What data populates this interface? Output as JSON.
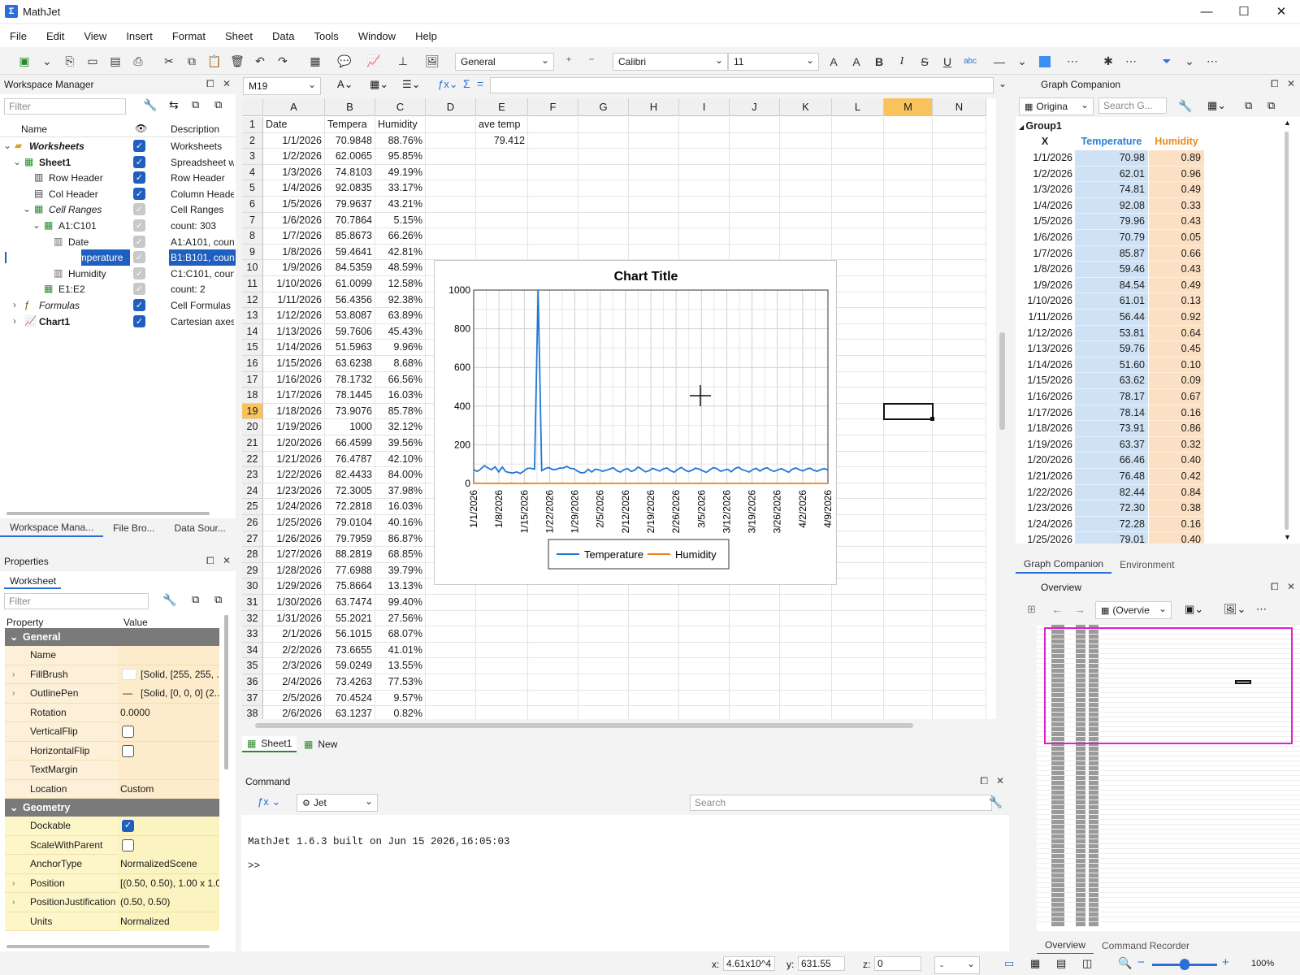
{
  "app": {
    "title": "MathJet"
  },
  "menu": [
    "File",
    "Edit",
    "View",
    "Insert",
    "Format",
    "Sheet",
    "Data",
    "Tools",
    "Window",
    "Help"
  ],
  "toolbar": {
    "number_format": "General",
    "font_name": "Calibri",
    "font_size": "11"
  },
  "workspace": {
    "title": "Workspace Manager",
    "filter_placeholder": "Filter",
    "col_name": "Name",
    "col_desc": "Description",
    "rows": [
      {
        "name": "Worksheets",
        "desc": "Worksheets",
        "indent": 0,
        "bold": true,
        "italic": true,
        "check": "on",
        "expand": "⌄",
        "icon": "folder-icon"
      },
      {
        "name": "Sheet1",
        "desc": "Spreadsheet wi",
        "indent": 1,
        "bold": true,
        "italic": false,
        "check": "on",
        "expand": "⌄",
        "icon": "sheet-icon"
      },
      {
        "name": "Row Header",
        "desc": "Row Header",
        "indent": 2,
        "bold": false,
        "italic": false,
        "check": "on",
        "expand": "",
        "icon": "row-header-icon"
      },
      {
        "name": "Col Header",
        "desc": "Column Heade",
        "indent": 2,
        "bold": false,
        "italic": false,
        "check": "on",
        "expand": "",
        "icon": "col-header-icon"
      },
      {
        "name": "Cell Ranges",
        "desc": "Cell Ranges",
        "indent": 2,
        "bold": false,
        "italic": true,
        "check": "gray",
        "expand": "⌄",
        "icon": "cell-ranges-icon"
      },
      {
        "name": "A1:C101",
        "desc": "count: 303",
        "indent": 3,
        "bold": false,
        "italic": false,
        "check": "gray",
        "expand": "⌄",
        "icon": "range-icon"
      },
      {
        "name": "Date",
        "desc": "A1:A101, count",
        "indent": 4,
        "bold": false,
        "italic": false,
        "check": "gray",
        "expand": "",
        "icon": "column-icon"
      },
      {
        "name": "Temperature",
        "desc": "B1:B101, count",
        "indent": 4,
        "bold": false,
        "italic": false,
        "check": "gray",
        "expand": "",
        "icon": "column-icon",
        "selected": true
      },
      {
        "name": "Humidity",
        "desc": "C1:C101, count",
        "indent": 4,
        "bold": false,
        "italic": false,
        "check": "gray",
        "expand": "",
        "icon": "column-icon"
      },
      {
        "name": "E1:E2",
        "desc": "count: 2",
        "indent": 3,
        "bold": false,
        "italic": false,
        "check": "gray",
        "expand": "",
        "icon": "range-icon"
      },
      {
        "name": "Formulas",
        "desc": "Cell Formulas",
        "indent": 1,
        "bold": false,
        "italic": true,
        "check": "on",
        "expand": "›",
        "icon": "formula-icon"
      },
      {
        "name": "Chart1",
        "desc": "Cartesian axes",
        "indent": 1,
        "bold": true,
        "italic": false,
        "check": "on",
        "expand": "›",
        "icon": "chart-icon"
      }
    ],
    "tabs": [
      "Workspace Mana...",
      "File Bro...",
      "Data Sour..."
    ]
  },
  "properties": {
    "title": "Properties",
    "tab": "Worksheet",
    "filter_placeholder": "Filter",
    "col_property": "Property",
    "col_value": "Value",
    "sections": [
      {
        "name": "General",
        "rows": [
          {
            "k": "Name",
            "v": "",
            "ex": ""
          },
          {
            "k": "FillBrush",
            "v": "[Solid, [255, 255, ...",
            "ex": "›"
          },
          {
            "k": "OutlinePen",
            "v": "[Solid, [0, 0, 0] (2...",
            "ex": "›"
          },
          {
            "k": "Rotation",
            "v": "0.0000",
            "ex": ""
          },
          {
            "k": "VerticalFlip",
            "v": "",
            "ex": "",
            "check": "off"
          },
          {
            "k": "HorizontalFlip",
            "v": "",
            "ex": "",
            "check": "off"
          },
          {
            "k": "TextMargin",
            "v": "",
            "ex": ""
          },
          {
            "k": "Location",
            "v": "Custom",
            "ex": ""
          }
        ]
      },
      {
        "name": "Geometry",
        "rows": [
          {
            "k": "Dockable",
            "v": "",
            "ex": "",
            "check": "on"
          },
          {
            "k": "ScaleWithParent",
            "v": "",
            "ex": "",
            "check": "off"
          },
          {
            "k": "AnchorType",
            "v": "NormalizedScene",
            "ex": ""
          },
          {
            "k": "Position",
            "v": "[(0.50, 0.50), 1.00 x 1.00]",
            "ex": "›"
          },
          {
            "k": "PositionJustification",
            "v": "(0.50, 0.50)",
            "ex": "›"
          },
          {
            "k": "Units",
            "v": "Normalized",
            "ex": ""
          }
        ]
      }
    ]
  },
  "formula_bar": {
    "name_box": "M19",
    "formula": ""
  },
  "sheet": {
    "columns": [
      "A",
      "B",
      "C",
      "D",
      "E",
      "F",
      "G",
      "H",
      "I",
      "J",
      "K",
      "L",
      "M",
      "N"
    ],
    "header_row": [
      "Date",
      "Tempera",
      "Humidity",
      "",
      "ave temp"
    ],
    "e2": "79.412",
    "active_row": 19,
    "active_col": "M",
    "rows": [
      [
        "1/1/2026",
        "70.9848",
        "88.76%"
      ],
      [
        "1/2/2026",
        "62.0065",
        "95.85%"
      ],
      [
        "1/3/2026",
        "74.8103",
        "49.19%"
      ],
      [
        "1/4/2026",
        "92.0835",
        "33.17%"
      ],
      [
        "1/5/2026",
        "79.9637",
        "43.21%"
      ],
      [
        "1/6/2026",
        "70.7864",
        "5.15%"
      ],
      [
        "1/7/2026",
        "85.8673",
        "66.26%"
      ],
      [
        "1/8/2026",
        "59.4641",
        "42.81%"
      ],
      [
        "1/9/2026",
        "84.5359",
        "48.59%"
      ],
      [
        "1/10/2026",
        "61.0099",
        "12.58%"
      ],
      [
        "1/11/2026",
        "56.4356",
        "92.38%"
      ],
      [
        "1/12/2026",
        "53.8087",
        "63.89%"
      ],
      [
        "1/13/2026",
        "59.7606",
        "45.43%"
      ],
      [
        "1/14/2026",
        "51.5963",
        "9.96%"
      ],
      [
        "1/15/2026",
        "63.6238",
        "8.68%"
      ],
      [
        "1/16/2026",
        "78.1732",
        "66.56%"
      ],
      [
        "1/17/2026",
        "78.1445",
        "16.03%"
      ],
      [
        "1/18/2026",
        "73.9076",
        "85.78%"
      ],
      [
        "1/19/2026",
        "1000",
        "32.12%"
      ],
      [
        "1/20/2026",
        "66.4599",
        "39.56%"
      ],
      [
        "1/21/2026",
        "76.4787",
        "42.10%"
      ],
      [
        "1/22/2026",
        "82.4433",
        "84.00%"
      ],
      [
        "1/23/2026",
        "72.3005",
        "37.98%"
      ],
      [
        "1/24/2026",
        "72.2818",
        "16.03%"
      ],
      [
        "1/25/2026",
        "79.0104",
        "40.16%"
      ],
      [
        "1/26/2026",
        "79.7959",
        "86.87%"
      ],
      [
        "1/27/2026",
        "88.2819",
        "68.85%"
      ],
      [
        "1/28/2026",
        "77.6988",
        "39.79%"
      ],
      [
        "1/29/2026",
        "75.8664",
        "13.13%"
      ],
      [
        "1/30/2026",
        "63.7474",
        "99.40%"
      ],
      [
        "1/31/2026",
        "55.2021",
        "27.56%"
      ],
      [
        "2/1/2026",
        "56.1015",
        "68.07%"
      ],
      [
        "2/2/2026",
        "73.6655",
        "41.01%"
      ],
      [
        "2/3/2026",
        "59.0249",
        "13.55%"
      ],
      [
        "2/4/2026",
        "73.4263",
        "77.53%"
      ],
      [
        "2/5/2026",
        "70.4524",
        "9.57%"
      ],
      [
        "2/6/2026",
        "63.1237",
        "0.82%"
      ]
    ],
    "tabs": [
      "Sheet1",
      "New"
    ]
  },
  "chart_data": {
    "type": "line",
    "title": "Chart Title",
    "ylim": [
      0,
      1000
    ],
    "yticks": [
      0,
      200,
      400,
      600,
      800,
      1000
    ],
    "xtick_labels": [
      "1/1/2026",
      "1/8/2026",
      "1/15/2026",
      "1/22/2026",
      "1/29/2026",
      "2/5/2026",
      "2/12/2026",
      "2/19/2026",
      "2/26/2026",
      "3/5/2026",
      "3/12/2026",
      "3/19/2026",
      "3/26/2026",
      "4/2/2026",
      "4/9/2026"
    ],
    "legend": "bottom-center",
    "series": [
      {
        "name": "Temperature",
        "color": "#1f77d4",
        "values": [
          70.98,
          62.01,
          74.81,
          92.08,
          79.96,
          70.79,
          85.87,
          59.46,
          84.54,
          61.01,
          56.44,
          53.81,
          59.76,
          51.6,
          63.62,
          78.17,
          78.14,
          73.91,
          1000,
          66.46,
          76.48,
          82.44,
          72.3,
          72.28,
          79.01,
          79.8,
          88.28,
          77.7,
          75.87,
          63.75,
          55.2,
          56.1,
          73.67,
          59.02,
          73.43,
          70.45,
          63.12,
          68,
          74,
          81,
          66,
          59,
          71,
          77,
          62,
          69,
          85,
          73,
          60,
          66,
          78,
          71,
          64,
          75,
          80,
          67,
          58,
          72,
          83,
          70,
          61,
          68,
          79,
          74,
          65,
          57,
          70,
          82,
          76,
          63,
          69,
          73,
          60,
          77,
          84,
          71,
          66,
          59,
          72,
          78,
          64,
          75,
          81,
          69,
          62,
          70,
          76,
          67,
          58,
          73,
          80,
          71,
          65,
          74,
          79,
          68,
          63,
          72,
          77,
          69
        ],
        "note_visible_only": ""
      },
      {
        "name": "Humidity",
        "color": "#f07f1a",
        "values": [
          0.89,
          0.96,
          0.49,
          0.33,
          0.43,
          0.05,
          0.66,
          0.43,
          0.49,
          0.13,
          0.92,
          0.64,
          0.45,
          0.1,
          0.09,
          0.67,
          0.16,
          0.86,
          0.32,
          0.4,
          0.42,
          0.84,
          0.38,
          0.16,
          0.4,
          0.87,
          0.69,
          0.4,
          0.13,
          0.99,
          0.28,
          0.68,
          0.41,
          0.14,
          0.78,
          0.1,
          0.01,
          0.5,
          0.5,
          0.5,
          0.5,
          0.5,
          0.5,
          0.5,
          0.5,
          0.5,
          0.5,
          0.5,
          0.5,
          0.5,
          0.5,
          0.5,
          0.5,
          0.5,
          0.5,
          0.5,
          0.5,
          0.5,
          0.5,
          0.5,
          0.5,
          0.5,
          0.5,
          0.5,
          0.5,
          0.5,
          0.5,
          0.5,
          0.5,
          0.5,
          0.5,
          0.5,
          0.5,
          0.5,
          0.5,
          0.5,
          0.5,
          0.5,
          0.5,
          0.5,
          0.5,
          0.5,
          0.5,
          0.5,
          0.5,
          0.5,
          0.5,
          0.5,
          0.5,
          0.5,
          0.5,
          0.5,
          0.5,
          0.5,
          0.5,
          0.5,
          0.5,
          0.5,
          0.5,
          0.5,
          0.5
        ]
      }
    ]
  },
  "graph_companion": {
    "title": "Graph Companion",
    "source": "Origina",
    "search_placeholder": "Search G...",
    "group": "Group1",
    "col_x": "X",
    "col_t": "Temperature",
    "col_h": "Humidity",
    "rows": [
      [
        "1/1/2026",
        "70.98",
        "0.89"
      ],
      [
        "1/2/2026",
        "62.01",
        "0.96"
      ],
      [
        "1/3/2026",
        "74.81",
        "0.49"
      ],
      [
        "1/4/2026",
        "92.08",
        "0.33"
      ],
      [
        "1/5/2026",
        "79.96",
        "0.43"
      ],
      [
        "1/6/2026",
        "70.79",
        "0.05"
      ],
      [
        "1/7/2026",
        "85.87",
        "0.66"
      ],
      [
        "1/8/2026",
        "59.46",
        "0.43"
      ],
      [
        "1/9/2026",
        "84.54",
        "0.49"
      ],
      [
        "1/10/2026",
        "61.01",
        "0.13"
      ],
      [
        "1/11/2026",
        "56.44",
        "0.92"
      ],
      [
        "1/12/2026",
        "53.81",
        "0.64"
      ],
      [
        "1/13/2026",
        "59.76",
        "0.45"
      ],
      [
        "1/14/2026",
        "51.60",
        "0.10"
      ],
      [
        "1/15/2026",
        "63.62",
        "0.09"
      ],
      [
        "1/16/2026",
        "78.17",
        "0.67"
      ],
      [
        "1/17/2026",
        "78.14",
        "0.16"
      ],
      [
        "1/18/2026",
        "73.91",
        "0.86"
      ],
      [
        "1/19/2026",
        "63.37",
        "0.32"
      ],
      [
        "1/20/2026",
        "66.46",
        "0.40"
      ],
      [
        "1/21/2026",
        "76.48",
        "0.42"
      ],
      [
        "1/22/2026",
        "82.44",
        "0.84"
      ],
      [
        "1/23/2026",
        "72.30",
        "0.38"
      ],
      [
        "1/24/2026",
        "72.28",
        "0.16"
      ],
      [
        "1/25/2026",
        "79.01",
        "0.40"
      ]
    ],
    "tabs": [
      "Graph Companion",
      "Environment"
    ]
  },
  "overview": {
    "title": "Overview",
    "combo": "(Overvie",
    "tabs": [
      "Overview",
      "Command Recorder"
    ]
  },
  "command": {
    "title": "Command",
    "engine": "Jet",
    "search_placeholder": "Search",
    "line1": "MathJet 1.6.3 built on Jun 15 2026,16:05:03",
    "prompt": ">>"
  },
  "status": {
    "x_label": "x:",
    "x_value": "4.61x10^4",
    "y_label": "y:",
    "y_value": "631.55",
    "z_label": "z:",
    "z_value": "0",
    "combo": "-",
    "zoom": "100%"
  }
}
